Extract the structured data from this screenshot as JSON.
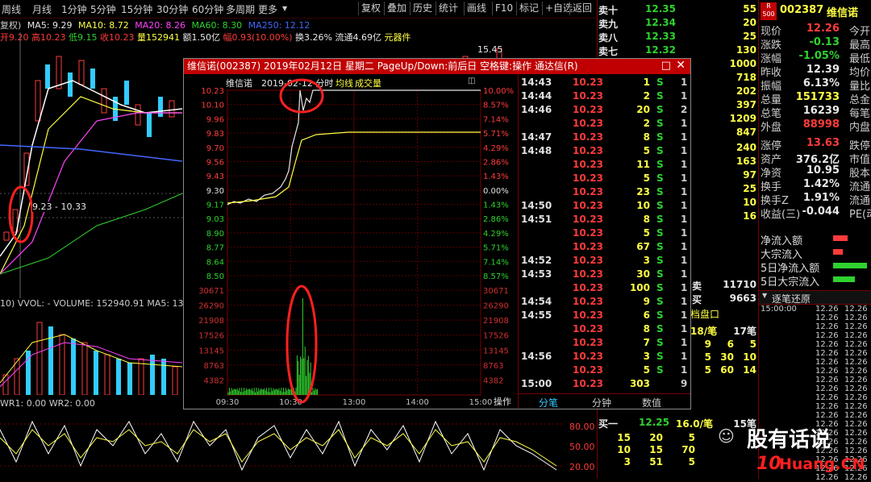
{
  "toolbar": {
    "left_items": [
      "周线",
      "月线",
      "1分钟",
      "5分钟",
      "15分钟",
      "30分钟",
      "60分钟",
      "多周期",
      "更多"
    ],
    "right_items": [
      "复权",
      "叠加",
      "历史",
      "统计",
      "画线",
      "F10",
      "标记",
      "+自选",
      "返回"
    ]
  },
  "ma_line": {
    "prefix": "复权)",
    "ma5": "MA5: 9.29",
    "ma10": "MA10: 8.72",
    "ma20": "MA20: 8.26",
    "ma60": "MA60: 8.30",
    "ma250": "MA250: 12.12"
  },
  "quote_line": {
    "open": "开9.20",
    "high": "高10.23",
    "low": "低9.15",
    "close": "收10.23",
    "vol": "量152941",
    "amount": "额1.50亿",
    "change": "幅0.93(10.00%)",
    "turnover": "换3.26%",
    "float": "流通4.69亿",
    "sector": "元器件"
  },
  "main_chart": {
    "label_price": "15.45",
    "range_label": "9.23 - 10.33"
  },
  "volume_panel": {
    "header": "10) VVOL: -   VOLUME: 152940.91  MA5: 139"
  },
  "wr_panel": {
    "header": "WR1: 0.00  WR2: 0.00",
    "levels": [
      "80.00",
      "50.00",
      "20.00"
    ]
  },
  "dialog": {
    "title": "维信诺(002387) 2019年02月12日 星期二 PageUp/Down:前后日 空格键:操作 通达信(R)",
    "chart_title": "维信诺",
    "chart_date": "2019-02-12 分时",
    "legend_avg": "均线",
    "legend_vol": "成交量",
    "price_ticks": [
      "10.23",
      "10.10",
      "9.96",
      "9.83",
      "9.70",
      "9.56",
      "9.43",
      "9.30",
      "9.17",
      "9.03",
      "8.90",
      "8.77",
      "8.64",
      "8.50"
    ],
    "pct_ticks": [
      "10.00%",
      "8.57%",
      "7.14%",
      "5.71%",
      "4.29%",
      "2.86%",
      "1.43%",
      "0.00%",
      "1.43%",
      "2.86%",
      "4.29%",
      "5.71%",
      "7.14%",
      "8.57%"
    ],
    "vol_ticks": [
      "30671",
      "26290",
      "21908",
      "17526",
      "13145",
      "8763",
      "4382"
    ],
    "time_ticks": [
      "09:30",
      "10:30",
      "13:00",
      "14:00",
      "15:00"
    ],
    "op_label": "操作",
    "tabs": [
      "分笔",
      "分钟",
      "数值"
    ],
    "trades": [
      {
        "time": "14:43",
        "price": "10.23",
        "vol": "1",
        "side": "S",
        "cnt": "1"
      },
      {
        "time": "14:44",
        "price": "10.23",
        "vol": "2",
        "side": "S",
        "cnt": "1"
      },
      {
        "time": "14:46",
        "price": "10.23",
        "vol": "20",
        "side": "S",
        "cnt": "2"
      },
      {
        "time": "",
        "price": "10.23",
        "vol": "2",
        "side": "S",
        "cnt": "1"
      },
      {
        "time": "14:47",
        "price": "10.23",
        "vol": "8",
        "side": "S",
        "cnt": "1"
      },
      {
        "time": "14:48",
        "price": "10.23",
        "vol": "5",
        "side": "S",
        "cnt": "1"
      },
      {
        "time": "",
        "price": "10.23",
        "vol": "11",
        "side": "S",
        "cnt": "1"
      },
      {
        "time": "",
        "price": "10.23",
        "vol": "5",
        "side": "S",
        "cnt": "1"
      },
      {
        "time": "",
        "price": "10.23",
        "vol": "23",
        "side": "S",
        "cnt": "1"
      },
      {
        "time": "14:50",
        "price": "10.23",
        "vol": "10",
        "side": "S",
        "cnt": "1"
      },
      {
        "time": "14:51",
        "price": "10.23",
        "vol": "8",
        "side": "S",
        "cnt": "1"
      },
      {
        "time": "",
        "price": "10.23",
        "vol": "5",
        "side": "S",
        "cnt": "1"
      },
      {
        "time": "",
        "price": "10.23",
        "vol": "67",
        "side": "S",
        "cnt": "1"
      },
      {
        "time": "14:52",
        "price": "10.23",
        "vol": "3",
        "side": "S",
        "cnt": "1"
      },
      {
        "time": "14:53",
        "price": "10.23",
        "vol": "30",
        "side": "S",
        "cnt": "1"
      },
      {
        "time": "",
        "price": "10.23",
        "vol": "100",
        "side": "S",
        "cnt": "1"
      },
      {
        "time": "14:54",
        "price": "10.23",
        "vol": "9",
        "side": "S",
        "cnt": "1"
      },
      {
        "time": "14:55",
        "price": "10.23",
        "vol": "6",
        "side": "S",
        "cnt": "1"
      },
      {
        "time": "",
        "price": "10.23",
        "vol": "8",
        "side": "S",
        "cnt": "1"
      },
      {
        "time": "",
        "price": "10.23",
        "vol": "7",
        "side": "S",
        "cnt": "1"
      },
      {
        "time": "14:56",
        "price": "10.23",
        "vol": "3",
        "side": "S",
        "cnt": "1"
      },
      {
        "time": "",
        "price": "10.23",
        "vol": "5",
        "side": "S",
        "cnt": "1"
      },
      {
        "time": "15:00",
        "price": "10.23",
        "vol": "303",
        "side": "",
        "cnt": "9"
      }
    ]
  },
  "order_book": {
    "sells": [
      {
        "label": "卖十",
        "price": "12.35",
        "vol": "55"
      },
      {
        "label": "卖九",
        "price": "12.34",
        "vol": "20"
      },
      {
        "label": "卖八",
        "price": "12.33",
        "vol": "25"
      },
      {
        "label": "卖七",
        "price": "12.32",
        "vol": "130"
      }
    ],
    "extra_vols": [
      "1000",
      "718",
      "202",
      "397",
      "1209",
      "847",
      "240",
      "163",
      "97",
      "25",
      "10",
      "16"
    ],
    "outer_inner": [
      {
        "label": "卖",
        "value": "11710"
      },
      {
        "label": "买",
        "value": "9663"
      }
    ],
    "panel_label": "档盘口",
    "bi_header": {
      "left": "18/笔",
      "right": "17笔"
    },
    "bi_rows": [
      [
        "9",
        "6",
        "5"
      ],
      [
        "5",
        "30",
        "10"
      ],
      [
        "5",
        "60",
        "14"
      ]
    ],
    "buy1": {
      "label": "买一",
      "price": "12.25",
      "vol": "16.0/笔",
      "right": "15笔"
    },
    "buy_rows": [
      [
        "15",
        "20",
        "5"
      ],
      [
        "10",
        "15",
        "70"
      ],
      [
        "3",
        "51",
        "5"
      ]
    ]
  },
  "stock_info": {
    "badge": "R\n500",
    "code": "002387",
    "name": "维信诺",
    "rows": [
      {
        "label": "现价",
        "value": "12.26",
        "vclass": "red",
        "tail": "今开"
      },
      {
        "label": "涨跌",
        "value": "-0.13",
        "vclass": "grn",
        "tail": "最高"
      },
      {
        "label": "涨幅",
        "value": "-1.05%",
        "vclass": "grn",
        "tail": "最低"
      },
      {
        "label": "昨收",
        "value": "12.39",
        "vclass": "wht",
        "tail": "均价"
      },
      {
        "label": "振幅",
        "value": "6.13%",
        "vclass": "wht",
        "tail": "量比"
      },
      {
        "label": "总量",
        "value": "151733",
        "vclass": "yel",
        "tail": "总金"
      },
      {
        "label": "总笔",
        "value": "16239",
        "vclass": "wht",
        "tail": "每笔"
      },
      {
        "label": "外盘",
        "value": "88998",
        "vclass": "red",
        "tail": "内盘"
      },
      {
        "label": "涨停",
        "value": "13.63",
        "vclass": "red",
        "tail": "跌停"
      },
      {
        "label": "资产",
        "value": "376.2亿",
        "vclass": "wht",
        "tail": "市值"
      },
      {
        "label": "净资",
        "value": "10.95",
        "vclass": "wht",
        "tail": "股本"
      },
      {
        "label": "换手",
        "value": "1.42%",
        "vclass": "wht",
        "tail": "流通"
      },
      {
        "label": "换手Z",
        "value": "1.91%",
        "vclass": "wht",
        "tail": "流通"
      },
      {
        "label": "收益(三)",
        "value": "-0.044",
        "vclass": "wht",
        "tail": "PE(动)"
      }
    ],
    "flows": [
      {
        "label": "净流入额",
        "bar": "red",
        "w": 0.3
      },
      {
        "label": "大宗流入",
        "bar": "red",
        "w": 0.2
      },
      {
        "label": "5日净流入额",
        "bar": "grn",
        "w": 0.7
      },
      {
        "label": "5日大宗流入",
        "bar": "grn",
        "w": 0.45
      }
    ],
    "replay_label": "逐笔还原",
    "replay_rows": [
      [
        "15:00:00",
        "12.26",
        "12.26"
      ],
      [
        "",
        "12.26",
        "12.26"
      ],
      [
        "",
        "12.26",
        "12.26"
      ],
      [
        "",
        "12.26",
        "12.26"
      ],
      [
        "",
        "12.26",
        "12.26"
      ],
      [
        "",
        "12.26",
        "12.26"
      ],
      [
        "",
        "12.26",
        "12.26"
      ],
      [
        "",
        "12.26",
        "12.26"
      ],
      [
        "",
        "12.26",
        "12.26"
      ],
      [
        "",
        "12.26",
        "12.26"
      ],
      [
        "",
        "12.26",
        "12.26"
      ],
      [
        "",
        "12.26",
        "12.26"
      ],
      [
        "",
        "12.26",
        "12.26"
      ],
      [
        "",
        "12.26",
        "12.26"
      ],
      [
        "",
        "12.26",
        "12.26"
      ],
      [
        "",
        "12.26",
        "12.26"
      ],
      [
        "",
        "12.26",
        "12.26"
      ],
      [
        "",
        "12.26",
        "12.26"
      ],
      [
        "",
        "12.26",
        "12.26"
      ],
      [
        "",
        "12.26",
        "12.26"
      ]
    ]
  },
  "watermark": {
    "text": "股有话说",
    "domain": "Huang.CN",
    "domain_prefix": "10"
  },
  "colors": {
    "up": "#ff3b3b",
    "down": "#2fd22f",
    "yellow": "#ffff44",
    "title_red": "#c00000"
  }
}
